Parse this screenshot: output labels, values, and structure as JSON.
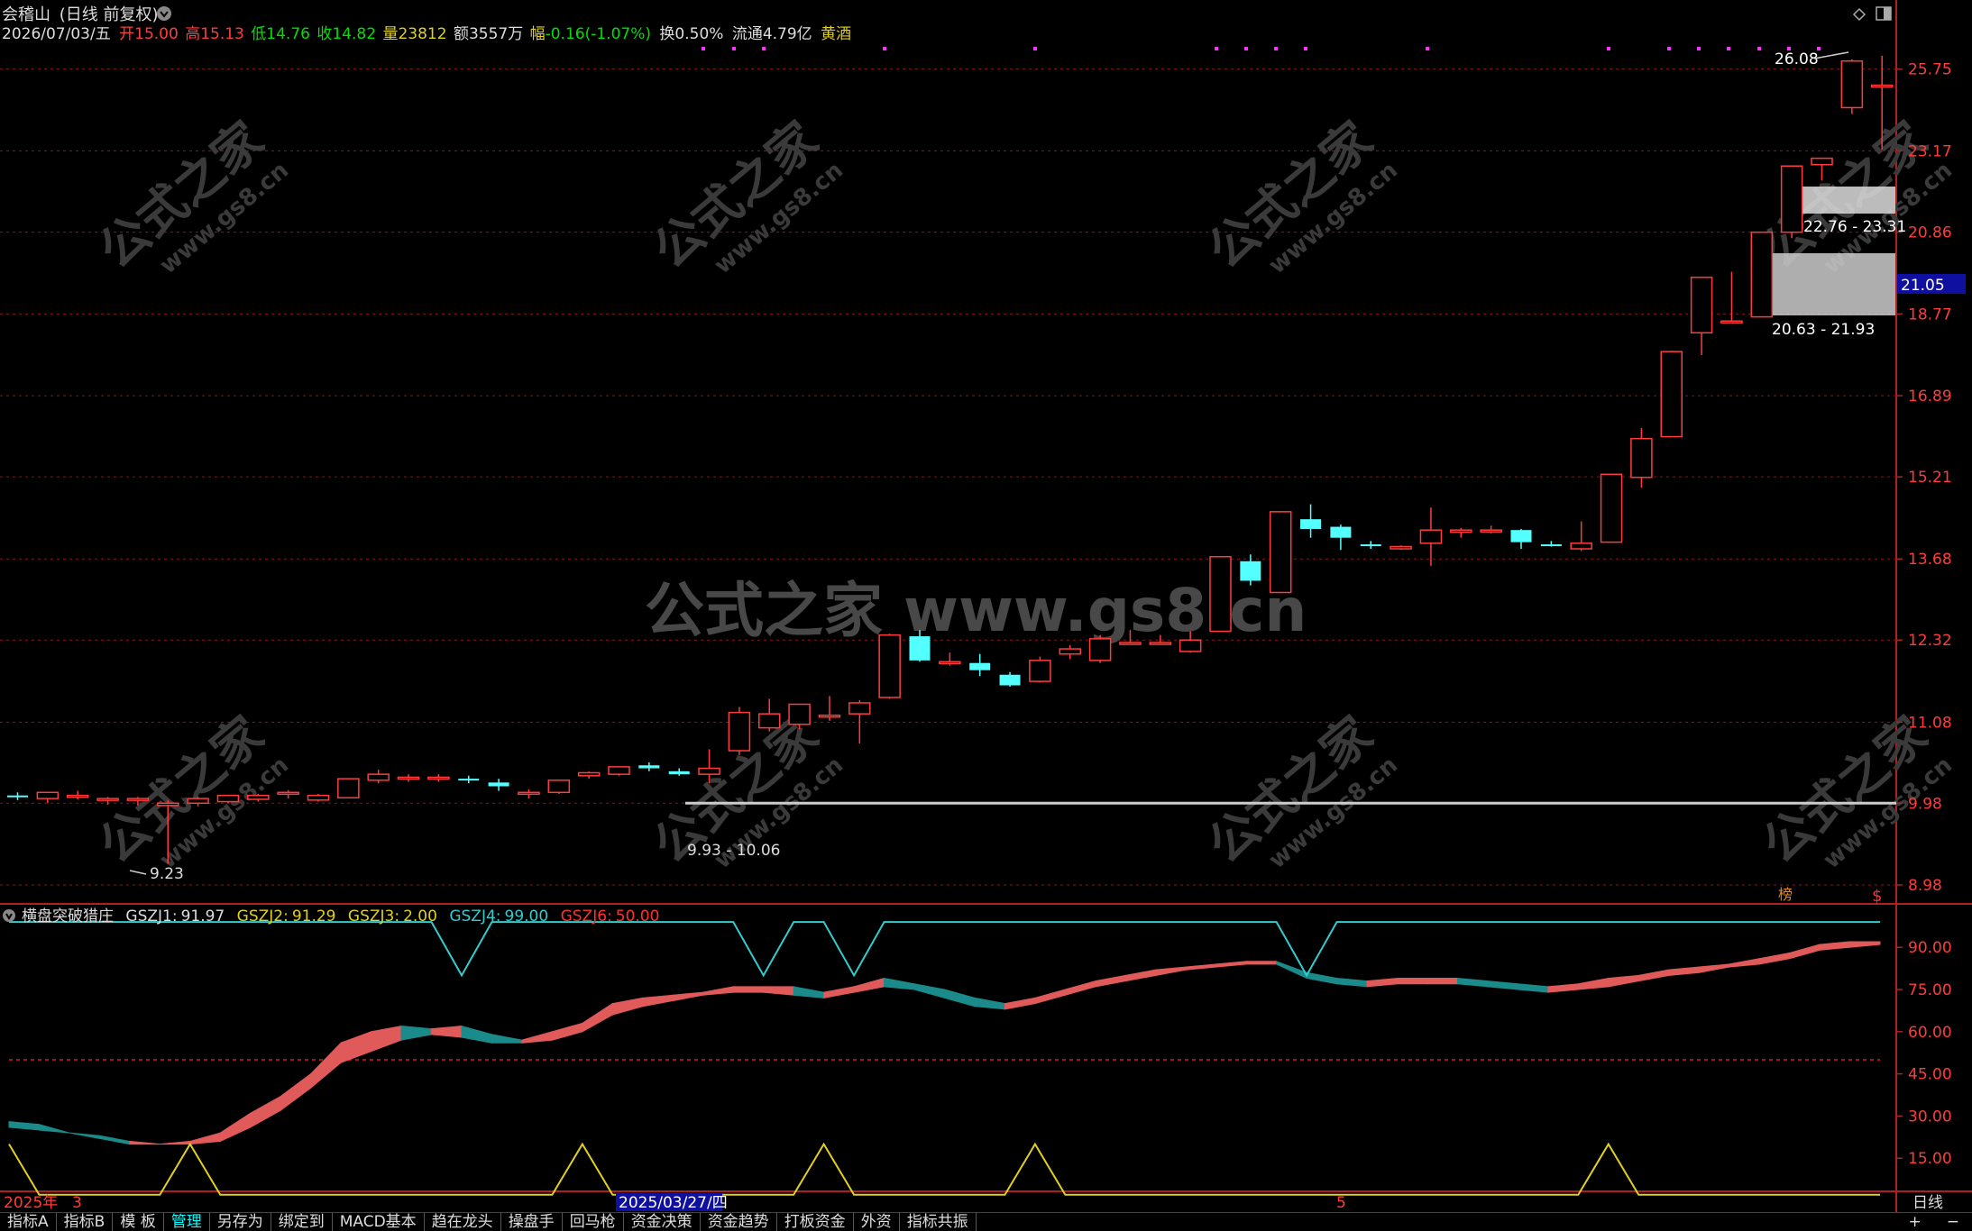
{
  "header": {
    "stock_name": "会稽山",
    "mode": "(日线 前复权)",
    "date": "2026/07/03/五",
    "open_label": "开",
    "open": "15.00",
    "high_label": "高",
    "high": "15.13",
    "low_label": "低",
    "low": "14.76",
    "close_label": "收",
    "close": "14.82",
    "vol_label": "量",
    "vol": "23812",
    "amt_label": "额",
    "amt": "3557万",
    "chg_label": "幅",
    "chg": "-0.16(-1.07%)",
    "turnover": "换0.50%",
    "float_cap": "流通4.79亿",
    "sector": "黄酒"
  },
  "price_axis": [
    "25.75",
    "23.17",
    "20.86",
    "18.77",
    "16.89",
    "15.21",
    "13.68",
    "12.32",
    "11.08",
    "9.98",
    "8.98"
  ],
  "current_price": "21.05",
  "annotations": {
    "high_mark": "26.08",
    "low_mark": "9.23",
    "zone_upper": "22.76 - 23.31",
    "zone_lower": "20.63 - 21.93",
    "zone_base": "9.93 - 10.06",
    "bang": "榜",
    "dollar": "$"
  },
  "watermark": {
    "center": "公式之家 www.gs8.cn",
    "small_cn": "公式之家",
    "small_url": "www.gs8.cn"
  },
  "indicator": {
    "name": "横盘突破猎庄",
    "gszj1_label": "GSZJ1:",
    "gszj1": "91.97",
    "gszj2_label": "GSZJ2:",
    "gszj2": "91.29",
    "gszj3_label": "GSZJ3:",
    "gszj3": "2.00",
    "gszj4_label": "GSZJ4:",
    "gszj4": "99.00",
    "gszj6_label": "GSZJ6:",
    "gszj6": "50.00",
    "axis": [
      "90.00",
      "75.00",
      "60.00",
      "45.00",
      "30.00",
      "15.00"
    ]
  },
  "time_axis": {
    "start": "2025年",
    "m3": "3",
    "highlight_date": "2025/03/27/四",
    "m5": "5",
    "period": "日线"
  },
  "toolbar": {
    "items": [
      "指标A",
      "指标B",
      "模 板",
      "管理",
      "另存为",
      "绑定到",
      "MACD基本",
      "趋在龙头",
      "操盘手",
      "回马枪",
      "资金决策",
      "资金趋势",
      "打板资金",
      "外资",
      "指标共振"
    ],
    "active_index": 3,
    "plus": "+",
    "minus": "−"
  },
  "colors": {
    "up": "#ff3c3c",
    "down": "#54ffff",
    "band_up": "#e05a5a",
    "band_down": "#1a8a8a",
    "cyan_line": "#33cccc",
    "yellow_line": "#e0d020"
  },
  "chart_data": {
    "type": "candlestick",
    "candles": [
      [
        10.08,
        10.12,
        10.02,
        10.06
      ],
      [
        10.04,
        10.12,
        9.98,
        10.12
      ],
      [
        10.08,
        10.14,
        10.03,
        10.08
      ],
      [
        10.02,
        10.06,
        9.96,
        10.04
      ],
      [
        10.04,
        10.06,
        9.95,
        10.04
      ],
      [
        9.95,
        10.02,
        9.23,
        9.98
      ],
      [
        9.98,
        10.06,
        9.94,
        10.04
      ],
      [
        10.0,
        10.08,
        9.98,
        10.08
      ],
      [
        10.03,
        10.1,
        10.0,
        10.08
      ],
      [
        10.1,
        10.15,
        10.04,
        10.12
      ],
      [
        10.02,
        10.1,
        10.0,
        10.08
      ],
      [
        10.05,
        10.3,
        10.05,
        10.3
      ],
      [
        10.28,
        10.42,
        10.24,
        10.36
      ],
      [
        10.32,
        10.36,
        10.26,
        10.32
      ],
      [
        10.3,
        10.36,
        10.26,
        10.32
      ],
      [
        10.3,
        10.34,
        10.24,
        10.28
      ],
      [
        10.25,
        10.3,
        10.14,
        10.2
      ],
      [
        10.1,
        10.16,
        10.04,
        10.12
      ],
      [
        10.12,
        10.28,
        10.1,
        10.28
      ],
      [
        10.34,
        10.4,
        10.3,
        10.38
      ],
      [
        10.36,
        10.46,
        10.34,
        10.46
      ],
      [
        10.48,
        10.52,
        10.4,
        10.44
      ],
      [
        10.4,
        10.44,
        10.34,
        10.36
      ],
      [
        10.36,
        10.7,
        10.24,
        10.44
      ],
      [
        10.68,
        11.3,
        10.62,
        11.22
      ],
      [
        11.0,
        11.42,
        10.95,
        11.2
      ],
      [
        11.05,
        11.34,
        10.98,
        11.34
      ],
      [
        11.18,
        11.46,
        11.1,
        11.18
      ],
      [
        11.2,
        11.4,
        10.78,
        11.36
      ],
      [
        11.44,
        12.42,
        11.42,
        12.4
      ],
      [
        12.38,
        12.48,
        11.98,
        12.0
      ],
      [
        11.98,
        12.12,
        11.92,
        11.98
      ],
      [
        11.96,
        12.1,
        11.76,
        11.85
      ],
      [
        11.78,
        11.82,
        11.6,
        11.62
      ],
      [
        11.68,
        12.06,
        11.66,
        12.0
      ],
      [
        12.1,
        12.24,
        12.02,
        12.18
      ],
      [
        12.0,
        12.4,
        11.96,
        12.34
      ],
      [
        12.28,
        12.48,
        12.26,
        12.28
      ],
      [
        12.27,
        12.4,
        12.25,
        12.28
      ],
      [
        12.14,
        12.46,
        12.12,
        12.32
      ],
      [
        12.46,
        13.72,
        12.46,
        13.72
      ],
      [
        13.64,
        13.76,
        13.22,
        13.3
      ],
      [
        13.1,
        14.54,
        13.1,
        14.54
      ],
      [
        14.4,
        14.68,
        14.06,
        14.22
      ],
      [
        14.26,
        14.3,
        13.84,
        14.06
      ],
      [
        13.94,
        14.0,
        13.86,
        13.92
      ],
      [
        13.86,
        13.92,
        13.84,
        13.9
      ],
      [
        13.96,
        14.62,
        13.56,
        14.2
      ],
      [
        14.16,
        14.24,
        14.06,
        14.2
      ],
      [
        14.2,
        14.28,
        14.14,
        14.2
      ],
      [
        14.2,
        14.22,
        13.86,
        13.98
      ],
      [
        13.94,
        14.0,
        13.9,
        13.92
      ],
      [
        13.86,
        14.36,
        13.82,
        13.96
      ],
      [
        13.98,
        15.26,
        13.98,
        15.26
      ],
      [
        15.2,
        16.2,
        15.0,
        15.98
      ],
      [
        16.02,
        17.9,
        16.02,
        17.88
      ],
      [
        18.32,
        19.68,
        17.8,
        19.68
      ],
      [
        18.6,
        19.82,
        18.56,
        18.6
      ],
      [
        18.7,
        20.86,
        18.7,
        20.86
      ],
      [
        20.86,
        22.72,
        20.7,
        22.72
      ],
      [
        22.76,
        22.95,
        22.3,
        22.95
      ],
      [
        24.5,
        26.08,
        24.3,
        26.02
      ],
      [
        25.2,
        26.2,
        23.2,
        25.22
      ]
    ],
    "indicator_series": {
      "gszj1_band_top": [
        28,
        27,
        24,
        22,
        20,
        20,
        21,
        24,
        31,
        37,
        45,
        56,
        60,
        62,
        61,
        62,
        59,
        57,
        60,
        63,
        70,
        72,
        73,
        74,
        76,
        76,
        76,
        74,
        76,
        79,
        77,
        75,
        72,
        70,
        72,
        75,
        78,
        80,
        82,
        83,
        84,
        85,
        85,
        81,
        79,
        78,
        79,
        79,
        79,
        78,
        77,
        76,
        77,
        79,
        80,
        82,
        83,
        84,
        86,
        88,
        91,
        92,
        92
      ],
      "gszj2_band_bottom": [
        26,
        25,
        24,
        23,
        21,
        20,
        20,
        21,
        26,
        32,
        40,
        49,
        53,
        57,
        59,
        58,
        56,
        56,
        57,
        60,
        66,
        69,
        71,
        73,
        74,
        74,
        73,
        72,
        74,
        76,
        75,
        72,
        69,
        68,
        70,
        73,
        76,
        78,
        80,
        82,
        83,
        84,
        84,
        79,
        77,
        76,
        77,
        77,
        77,
        76,
        75,
        74,
        75,
        76,
        78,
        80,
        81,
        83,
        84,
        86,
        89,
        90,
        91
      ],
      "gszj4_cyan": [
        99,
        99,
        99,
        99,
        99,
        99,
        99,
        99,
        99,
        99,
        99,
        99,
        99,
        99,
        99,
        80,
        99,
        99,
        99,
        99,
        99,
        99,
        99,
        99,
        99,
        80,
        99,
        99,
        80,
        99,
        99,
        99,
        99,
        99,
        99,
        99,
        99,
        99,
        99,
        99,
        99,
        99,
        99,
        80,
        99,
        99,
        99,
        99,
        99,
        99,
        99,
        99,
        99,
        99,
        99,
        99,
        99,
        99,
        99,
        99,
        99,
        99,
        99
      ],
      "gszj3_yellow": [
        20,
        2,
        2,
        2,
        2,
        2,
        20,
        2,
        2,
        2,
        2,
        2,
        2,
        2,
        2,
        2,
        2,
        2,
        2,
        20,
        2,
        2,
        2,
        2,
        2,
        2,
        2,
        20,
        2,
        2,
        2,
        2,
        2,
        2,
        20,
        2,
        2,
        2,
        2,
        2,
        2,
        2,
        2,
        2,
        2,
        2,
        2,
        2,
        2,
        2,
        2,
        2,
        2,
        20,
        2,
        2,
        2,
        2,
        2,
        2,
        2,
        2,
        2
      ],
      "gszj6_level": 50
    },
    "ylim_price": [
      8.98,
      26.5
    ],
    "ylim_indicator": [
      0,
      100
    ]
  }
}
